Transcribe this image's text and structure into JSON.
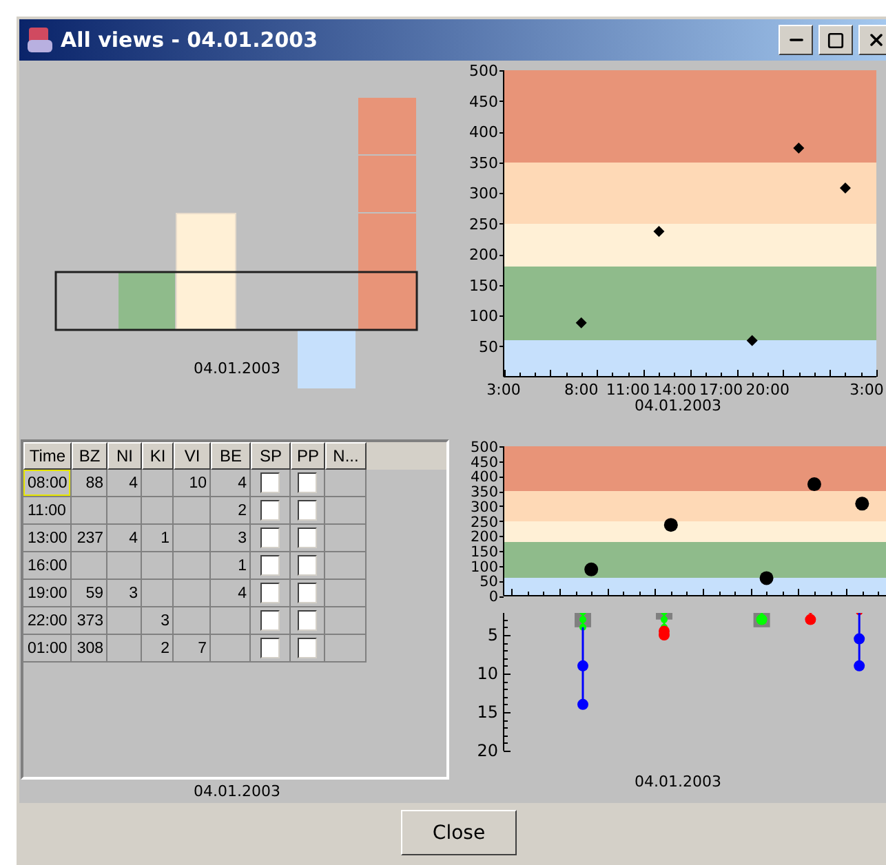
{
  "window": {
    "title": "All views - 04.01.2003"
  },
  "overview": {
    "caption": "04.01.2003"
  },
  "table": {
    "columns": [
      "Time",
      "BZ",
      "NI",
      "KI",
      "VI",
      "BE",
      "SP",
      "PP",
      "N..."
    ],
    "rows": [
      {
        "time": "08:00",
        "bz": "88",
        "ni": "4",
        "vi": "10",
        "be": "4",
        "sp": false,
        "pp": false,
        "selected": true
      },
      {
        "time": "11:00",
        "be": "2",
        "sp": false,
        "pp": false,
        "selected": false
      },
      {
        "time": "13:00",
        "bz": "237",
        "ni": "4",
        "ki": "1",
        "be": "3",
        "sp": false,
        "pp": false,
        "selected": false
      },
      {
        "time": "16:00",
        "be": "1",
        "sp": false,
        "pp": false,
        "selected": false
      },
      {
        "time": "19:00",
        "bz": "59",
        "ni": "3",
        "be": "4",
        "sp": false,
        "pp": false,
        "selected": false
      },
      {
        "time": "22:00",
        "bz": "373",
        "ki": "3",
        "sp": false,
        "pp": false,
        "selected": false
      },
      {
        "time": "01:00",
        "bz": "308",
        "ki": "2",
        "vi": "7",
        "sp": false,
        "pp": false,
        "selected": false
      }
    ],
    "caption": "04.01.2003"
  },
  "glucose_chart": {
    "chart_data": {
      "type": "scatter",
      "xlabel": "04.01.2003",
      "categories": [
        "3:00",
        null,
        null,
        null,
        null,
        "8:00",
        null,
        null,
        "11:00",
        null,
        null,
        "14:00",
        null,
        null,
        "17:00",
        null,
        null,
        "20:00",
        null,
        null,
        null,
        null,
        null,
        null,
        "3:00"
      ],
      "ylim": [
        0,
        500
      ],
      "yticks": [
        50,
        100,
        150,
        200,
        250,
        300,
        350,
        400,
        450,
        500
      ],
      "series": [
        {
          "color": "#000000",
          "values": [
            null,
            null,
            null,
            null,
            null,
            88,
            null,
            null,
            null,
            null,
            237,
            null,
            null,
            null,
            null,
            null,
            59,
            null,
            null,
            373,
            null,
            null,
            308,
            null,
            null
          ]
        }
      ],
      "bands": [
        {
          "axis": "y",
          "from": 0,
          "to": 60,
          "color": "#c6e0fc"
        },
        {
          "axis": "y",
          "from": 60,
          "to": 180,
          "color": "#8fbb8b"
        },
        {
          "axis": "y",
          "from": 180,
          "to": 250,
          "color": "#fff0d6"
        },
        {
          "axis": "y",
          "from": 250,
          "to": 350,
          "color": "#fed9b6"
        },
        {
          "axis": "y",
          "from": 350,
          "to": 500,
          "color": "#e89478"
        }
      ]
    }
  },
  "combined_chart": {
    "chart_data": {
      "type": "scatter",
      "categories": [
        null,
        null,
        null,
        null,
        null,
        null,
        null,
        null,
        null,
        null,
        null,
        null,
        null,
        null,
        null,
        null,
        null,
        null,
        null,
        null,
        null,
        null,
        null,
        null
      ],
      "ylim": [
        0,
        500
      ],
      "yticks": [
        0,
        50,
        100,
        150,
        200,
        250,
        300,
        350,
        400,
        450,
        500
      ],
      "series": [
        {
          "color": "#000000",
          "values": [
            null,
            null,
            null,
            null,
            null,
            88,
            null,
            null,
            null,
            null,
            237,
            null,
            null,
            null,
            null,
            null,
            59,
            null,
            null,
            373,
            null,
            null,
            308,
            null
          ]
        }
      ],
      "bands": [
        {
          "axis": "y",
          "from": 0,
          "to": 60,
          "color": "#c6e0fc"
        },
        {
          "axis": "y",
          "from": 60,
          "to": 180,
          "color": "#8fbb8b"
        },
        {
          "axis": "y",
          "from": 180,
          "to": 250,
          "color": "#fff0d6"
        },
        {
          "axis": "y",
          "from": 250,
          "to": 350,
          "color": "#fed9b6"
        },
        {
          "axis": "y",
          "from": 350,
          "to": 500,
          "color": "#e89478"
        }
      ]
    }
  },
  "events_chart": {
    "axis_labels": [
      "5",
      "10",
      "15",
      "20"
    ],
    "caption": "04.01.2003"
  },
  "buttons": [
    "Close"
  ]
}
